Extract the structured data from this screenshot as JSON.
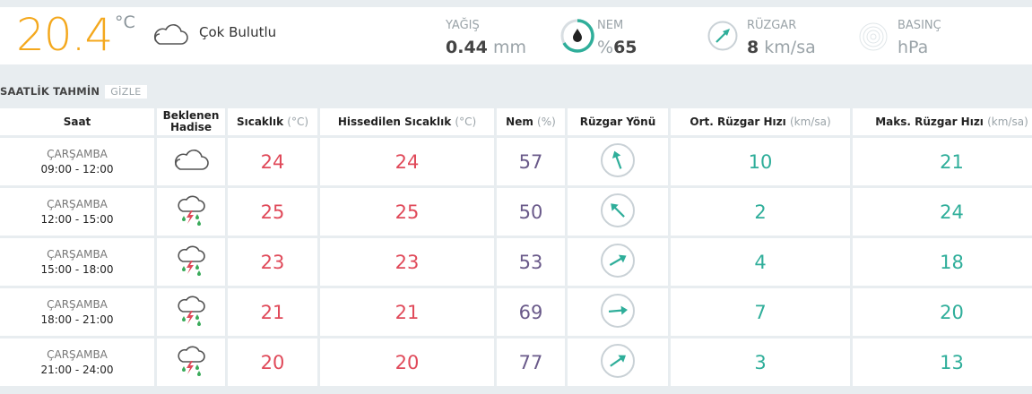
{
  "current": {
    "temperature": "20.4",
    "temperature_unit": "°C",
    "condition": "Çok Bulutlu",
    "precip_label": "YAĞIŞ",
    "precip_value": "0.44",
    "precip_unit": "mm",
    "humidity_label": "NEM",
    "humidity_prefix": "%",
    "humidity_value": "65",
    "wind_label": "RÜZGAR",
    "wind_value": "8",
    "wind_unit": "km/sa",
    "pressure_label": "BASINÇ",
    "pressure_unit": "hPa"
  },
  "section": {
    "title": "SAATLİK TAHMİN",
    "toggle_label": "GİZLE"
  },
  "headers": {
    "time": "Saat",
    "event_line1": "Beklenen",
    "event_line2": "Hadise",
    "temp": "Sıcaklık",
    "temp_unit": "(°C)",
    "feels": "Hissedilen Sıcaklık",
    "feels_unit": "(°C)",
    "hum": "Nem",
    "hum_unit": "(%)",
    "wind_dir": "Rüzgar Yönü",
    "avg_wind": "Ort. Rüzgar Hızı",
    "avg_wind_unit": "(km/sa)",
    "max_wind": "Maks. Rüzgar Hızı",
    "max_wind_unit": "(km/sa)"
  },
  "rows": [
    {
      "day": "ÇARŞAMBA",
      "time": "09:00 - 12:00",
      "icon": "cloud-icon",
      "temp": "24",
      "feels": "24",
      "hum": "57",
      "wind_dir_deg": 160,
      "avg": "10",
      "max": "21"
    },
    {
      "day": "ÇARŞAMBA",
      "time": "12:00 - 15:00",
      "icon": "thunder-rain-icon",
      "temp": "25",
      "feels": "25",
      "hum": "50",
      "wind_dir_deg": 135,
      "avg": "2",
      "max": "24"
    },
    {
      "day": "ÇARŞAMBA",
      "time": "15:00 - 18:00",
      "icon": "thunder-rain-icon",
      "temp": "23",
      "feels": "23",
      "hum": "53",
      "wind_dir_deg": 240,
      "avg": "4",
      "max": "18"
    },
    {
      "day": "ÇARŞAMBA",
      "time": "18:00 - 21:00",
      "icon": "thunder-rain-icon",
      "temp": "21",
      "feels": "21",
      "hum": "69",
      "wind_dir_deg": 265,
      "avg": "7",
      "max": "20"
    },
    {
      "day": "ÇARŞAMBA",
      "time": "21:00 - 24:00",
      "icon": "thunder-rain-icon",
      "temp": "20",
      "feels": "20",
      "hum": "77",
      "wind_dir_deg": 235,
      "avg": "3",
      "max": "13"
    }
  ],
  "colors": {
    "temperature": "#f4a81d",
    "red": "#e04a5a",
    "purple": "#6a5a8a",
    "green": "#2fae9a"
  }
}
